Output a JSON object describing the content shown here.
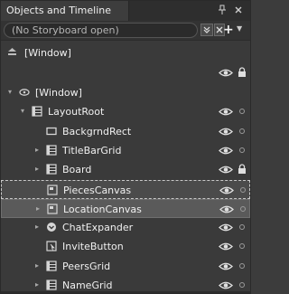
{
  "panel": {
    "title": "Objects and Timeline",
    "pin_icon": "pin-icon",
    "close_icon": "close-icon"
  },
  "storyboard": {
    "current": "(No Storyboard open)",
    "toggle_icon": "chevron-double-down-icon",
    "close_icon": "close-icon",
    "add_label": "+",
    "dropdown_icon": "triangle-down-icon"
  },
  "scope": {
    "label": "[Window]",
    "icon": "scope-up-icon"
  },
  "tree": [
    {
      "label": "[Window]",
      "icon": "window-icon",
      "expand": "expanded",
      "level": 0,
      "eye": false,
      "marker": "none"
    },
    {
      "label": "LayoutRoot",
      "icon": "grid-icon",
      "expand": "expanded",
      "level": 1,
      "eye": true,
      "marker": "dot"
    },
    {
      "label": "BackgrndRect",
      "icon": "rectangle-icon",
      "expand": "none",
      "level": 2,
      "eye": true,
      "marker": "dot"
    },
    {
      "label": "TitleBarGrid",
      "icon": "grid-icon",
      "expand": "collapsed",
      "level": 2,
      "eye": true,
      "marker": "dot"
    },
    {
      "label": "Board",
      "icon": "grid-icon",
      "expand": "collapsed",
      "level": 2,
      "eye": true,
      "marker": "lock"
    },
    {
      "label": "PiecesCanvas",
      "icon": "canvas-icon",
      "expand": "none",
      "level": 2,
      "eye": true,
      "marker": "dot",
      "state": "selected"
    },
    {
      "label": "LocationCanvas",
      "icon": "canvas-icon",
      "expand": "collapsed",
      "level": 2,
      "eye": true,
      "marker": "dot",
      "state": "highlighted"
    },
    {
      "label": "ChatExpander",
      "icon": "expander-icon",
      "expand": "collapsed",
      "level": 2,
      "eye": true,
      "marker": "dot"
    },
    {
      "label": "InviteButton",
      "icon": "button-icon",
      "expand": "none",
      "level": 2,
      "eye": true,
      "marker": "dot"
    },
    {
      "label": "PeersGrid",
      "icon": "grid-icon",
      "expand": "collapsed",
      "level": 2,
      "eye": true,
      "marker": "dot"
    },
    {
      "label": "NameGrid",
      "icon": "grid-icon",
      "expand": "collapsed",
      "level": 2,
      "eye": true,
      "marker": "dot"
    }
  ],
  "colors": {
    "panel_bg": "#3a3a3a",
    "selected_bg": "#4b4b4b",
    "highlight_bg": "#5a5a5a",
    "text": "#f0f0f0"
  }
}
